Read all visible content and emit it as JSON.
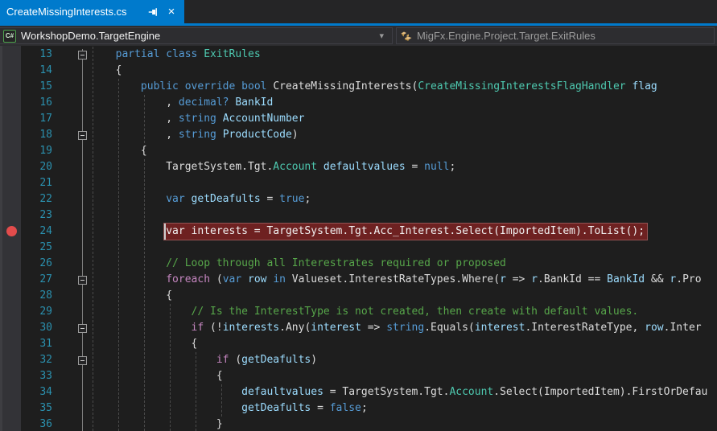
{
  "window": {
    "app": "Visual Studio code editor"
  },
  "tab": {
    "title": "CreateMissingInterests.cs",
    "pin_icon": "pin-icon",
    "close_icon": "×"
  },
  "navbar": {
    "project_dropdown": {
      "icon_text": "C#",
      "label": "WorkshopDemo.TargetEngine",
      "arrow": "▾"
    },
    "type_dropdown": {
      "icon": "class-icon",
      "label": "MigFx.Engine.Project.Target.ExitRules"
    }
  },
  "colors": {
    "accent": "#007acc",
    "tab_bg": "#007acc",
    "editor_bg": "#1e1e1e",
    "glyph_margin_bg": "#333337",
    "line_number": "#2b91af",
    "keyword": "#569cd6",
    "control_keyword": "#c586c0",
    "type": "#4ec9b0",
    "identifier": "#9cdcfe",
    "plain_text": "#dcdcdc",
    "comment": "#57a64a",
    "breakpoint_dot": "#e34c4c",
    "breakpoint_line_bg": "#6e2121"
  },
  "editor": {
    "breakpoint_line": 24,
    "lines": [
      {
        "n": 13,
        "indent": 8,
        "fold": true,
        "segs": [
          [
            "kw",
            "partial"
          ],
          [
            "pl",
            " "
          ],
          [
            "kw",
            "class"
          ],
          [
            "pl",
            " "
          ],
          [
            "ty",
            "ExitRules"
          ]
        ]
      },
      {
        "n": 14,
        "indent": 8,
        "segs": [
          [
            "pl",
            "{"
          ]
        ]
      },
      {
        "n": 15,
        "indent": 12,
        "segs": [
          [
            "kw",
            "public"
          ],
          [
            "pl",
            " "
          ],
          [
            "kw",
            "override"
          ],
          [
            "pl",
            " "
          ],
          [
            "kw",
            "bool"
          ],
          [
            "pl",
            " "
          ],
          [
            "pl",
            "CreateMissingInterests("
          ],
          [
            "ty",
            "CreateMissingInterestsFlagHandler"
          ],
          [
            "pl",
            " "
          ],
          [
            "id",
            "flag"
          ]
        ]
      },
      {
        "n": 16,
        "indent": 16,
        "segs": [
          [
            "pl",
            ", "
          ],
          [
            "kw",
            "decimal?"
          ],
          [
            "pl",
            " "
          ],
          [
            "id",
            "BankId"
          ]
        ]
      },
      {
        "n": 17,
        "indent": 16,
        "segs": [
          [
            "pl",
            ", "
          ],
          [
            "kw",
            "string"
          ],
          [
            "pl",
            " "
          ],
          [
            "id",
            "AccountNumber"
          ]
        ]
      },
      {
        "n": 18,
        "indent": 16,
        "fold": true,
        "segs": [
          [
            "pl",
            ", "
          ],
          [
            "kw",
            "string"
          ],
          [
            "pl",
            " "
          ],
          [
            "id",
            "ProductCode"
          ],
          [
            "pl",
            ")"
          ]
        ]
      },
      {
        "n": 19,
        "indent": 12,
        "segs": [
          [
            "pl",
            "{"
          ]
        ]
      },
      {
        "n": 20,
        "indent": 16,
        "segs": [
          [
            "pl",
            "TargetSystem.Tgt."
          ],
          [
            "ty",
            "Account"
          ],
          [
            "pl",
            " "
          ],
          [
            "id",
            "defaultvalues"
          ],
          [
            "pl",
            " = "
          ],
          [
            "kw",
            "null"
          ],
          [
            "pl",
            ";"
          ]
        ]
      },
      {
        "n": 21,
        "indent": 0,
        "segs": []
      },
      {
        "n": 22,
        "indent": 16,
        "segs": [
          [
            "kw",
            "var"
          ],
          [
            "pl",
            " "
          ],
          [
            "id",
            "getDeafults"
          ],
          [
            "pl",
            " = "
          ],
          [
            "kw",
            "true"
          ],
          [
            "pl",
            ";"
          ]
        ]
      },
      {
        "n": 23,
        "indent": 0,
        "segs": []
      },
      {
        "n": 24,
        "indent": 16,
        "breakpoint": true,
        "segs": [
          [
            "bp",
            "var interests = TargetSystem.Tgt.Acc_Interest.Select(ImportedItem).ToList();"
          ]
        ]
      },
      {
        "n": 25,
        "indent": 0,
        "segs": []
      },
      {
        "n": 26,
        "indent": 16,
        "segs": [
          [
            "cm",
            "// Loop through all Interestrates required or proposed"
          ]
        ]
      },
      {
        "n": 27,
        "indent": 16,
        "fold": true,
        "segs": [
          [
            "cf",
            "foreach"
          ],
          [
            "pl",
            " ("
          ],
          [
            "kw",
            "var"
          ],
          [
            "pl",
            " "
          ],
          [
            "id",
            "row"
          ],
          [
            "pl",
            " "
          ],
          [
            "kw",
            "in"
          ],
          [
            "pl",
            " Valueset.InterestRateTypes.Where("
          ],
          [
            "id",
            "r"
          ],
          [
            "pl",
            " => "
          ],
          [
            "id",
            "r"
          ],
          [
            "pl",
            ".BankId == "
          ],
          [
            "id",
            "BankId"
          ],
          [
            "pl",
            " && "
          ],
          [
            "id",
            "r"
          ],
          [
            "pl",
            ".Pro"
          ]
        ]
      },
      {
        "n": 28,
        "indent": 16,
        "segs": [
          [
            "pl",
            "{"
          ]
        ]
      },
      {
        "n": 29,
        "indent": 20,
        "segs": [
          [
            "cm",
            "// Is the InterestType is not created, then create with default values."
          ]
        ]
      },
      {
        "n": 30,
        "indent": 20,
        "fold": true,
        "segs": [
          [
            "cf",
            "if"
          ],
          [
            "pl",
            " (!"
          ],
          [
            "id",
            "interests"
          ],
          [
            "pl",
            ".Any("
          ],
          [
            "id",
            "interest"
          ],
          [
            "pl",
            " => "
          ],
          [
            "kw",
            "string"
          ],
          [
            "pl",
            ".Equals("
          ],
          [
            "id",
            "interest"
          ],
          [
            "pl",
            ".InterestRateType, "
          ],
          [
            "id",
            "row"
          ],
          [
            "pl",
            ".Inter"
          ]
        ]
      },
      {
        "n": 31,
        "indent": 20,
        "segs": [
          [
            "pl",
            "{"
          ]
        ]
      },
      {
        "n": 32,
        "indent": 24,
        "fold": true,
        "segs": [
          [
            "cf",
            "if"
          ],
          [
            "pl",
            " ("
          ],
          [
            "id",
            "getDeafults"
          ],
          [
            "pl",
            ")"
          ]
        ]
      },
      {
        "n": 33,
        "indent": 24,
        "segs": [
          [
            "pl",
            "{"
          ]
        ]
      },
      {
        "n": 34,
        "indent": 28,
        "segs": [
          [
            "id",
            "defaultvalues"
          ],
          [
            "pl",
            " = TargetSystem.Tgt."
          ],
          [
            "ty",
            "Account"
          ],
          [
            "pl",
            ".Select(ImportedItem).FirstOrDefau"
          ]
        ]
      },
      {
        "n": 35,
        "indent": 28,
        "segs": [
          [
            "id",
            "getDeafults"
          ],
          [
            "pl",
            " = "
          ],
          [
            "kw",
            "false"
          ],
          [
            "pl",
            ";"
          ]
        ]
      },
      {
        "n": 36,
        "indent": 24,
        "segs": [
          [
            "pl",
            "}"
          ]
        ]
      }
    ]
  }
}
